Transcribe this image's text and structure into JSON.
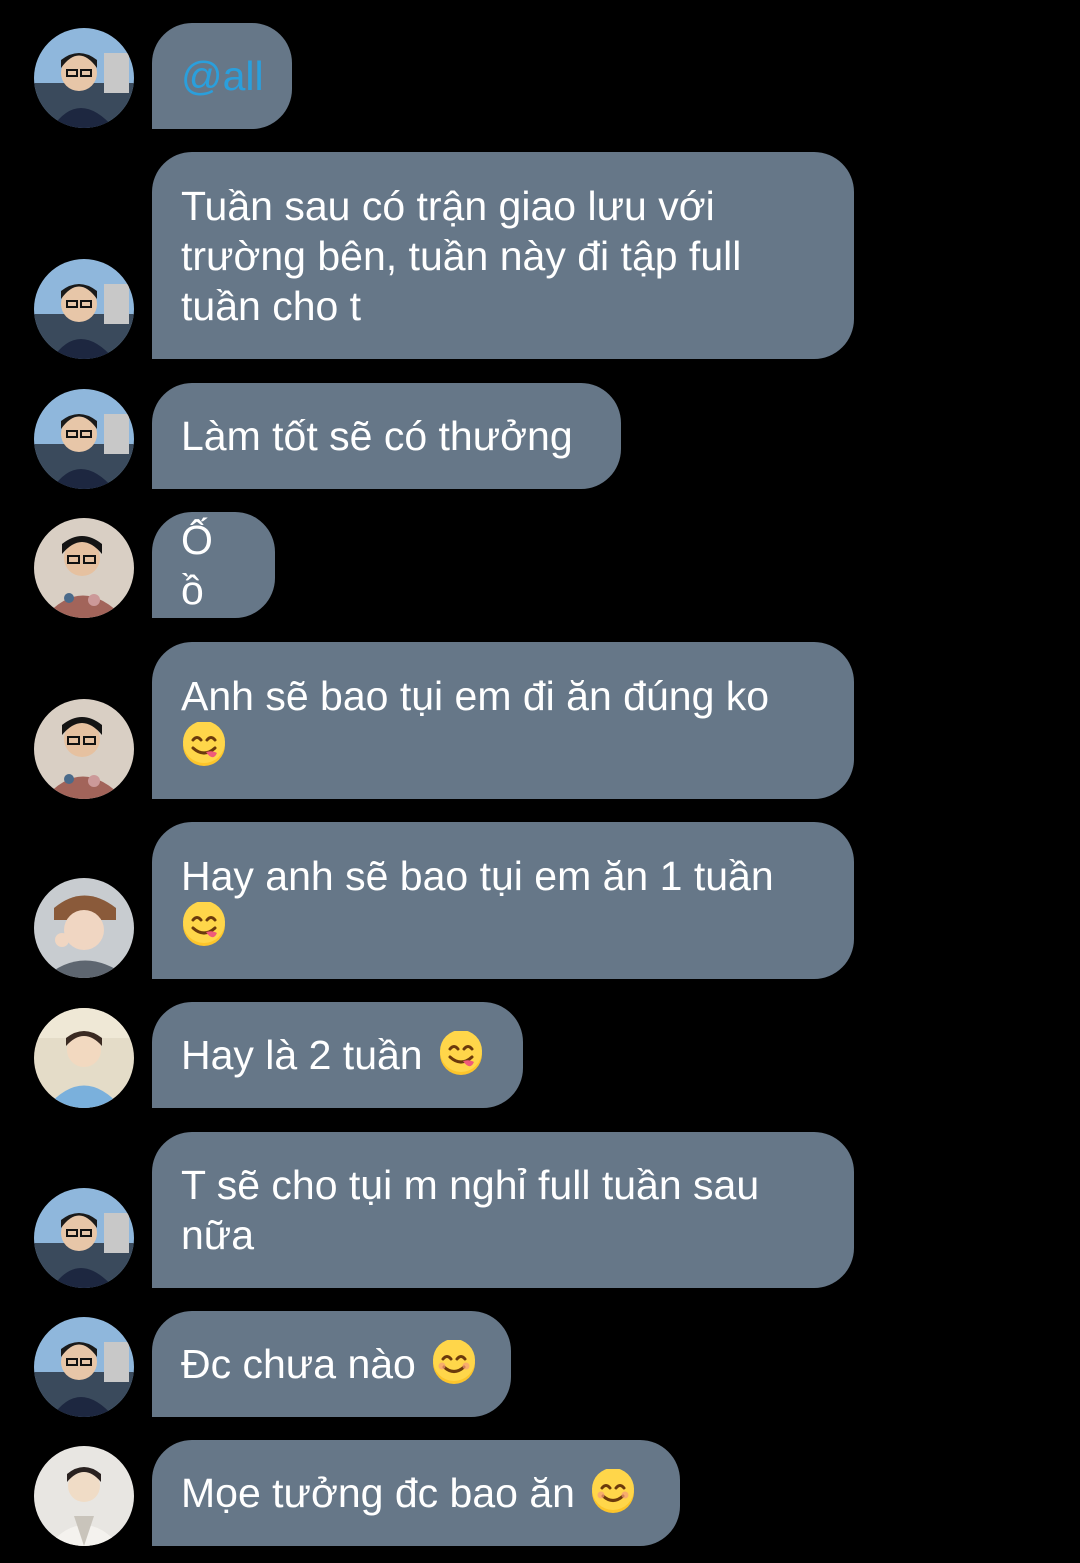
{
  "messages": [
    {
      "mention": "@all",
      "text": "",
      "avatar": "avatar-1",
      "emoji": ""
    },
    {
      "mention": "",
      "text": "Tuần sau có trận giao lưu với\ntrường bên, tuần này đi tập full\ntuần cho t",
      "avatar": "avatar-1",
      "emoji": ""
    },
    {
      "mention": "",
      "text": "Làm tốt sẽ có thưởng",
      "avatar": "avatar-1",
      "emoji": ""
    },
    {
      "mention": "",
      "text": "Ố ồ",
      "avatar": "avatar-2",
      "emoji": ""
    },
    {
      "mention": "",
      "text": "Anh sẽ bao tụi em đi ăn đúng ko\n",
      "avatar": "avatar-2",
      "emoji": "😋"
    },
    {
      "mention": "",
      "text": "Hay anh sẽ bao tụi em ăn 1 tuần\n",
      "avatar": "avatar-3",
      "emoji": "😋"
    },
    {
      "mention": "",
      "text": "Hay là 2 tuần ",
      "avatar": "avatar-4",
      "emoji": "😋"
    },
    {
      "mention": "",
      "text": "T sẽ cho tụi m nghỉ full tuần sau\nnữa",
      "avatar": "avatar-1",
      "emoji": ""
    },
    {
      "mention": "",
      "text": "Đc chưa nào ",
      "avatar": "avatar-1",
      "emoji": "😊"
    },
    {
      "mention": "",
      "text": "Mọe tưởng đc bao ăn ",
      "avatar": "avatar-5",
      "emoji": "😊"
    }
  ],
  "colors": {
    "background": "#000000",
    "bubble": "#667788",
    "text": "#ffffff",
    "mention": "#2a9fdc"
  }
}
